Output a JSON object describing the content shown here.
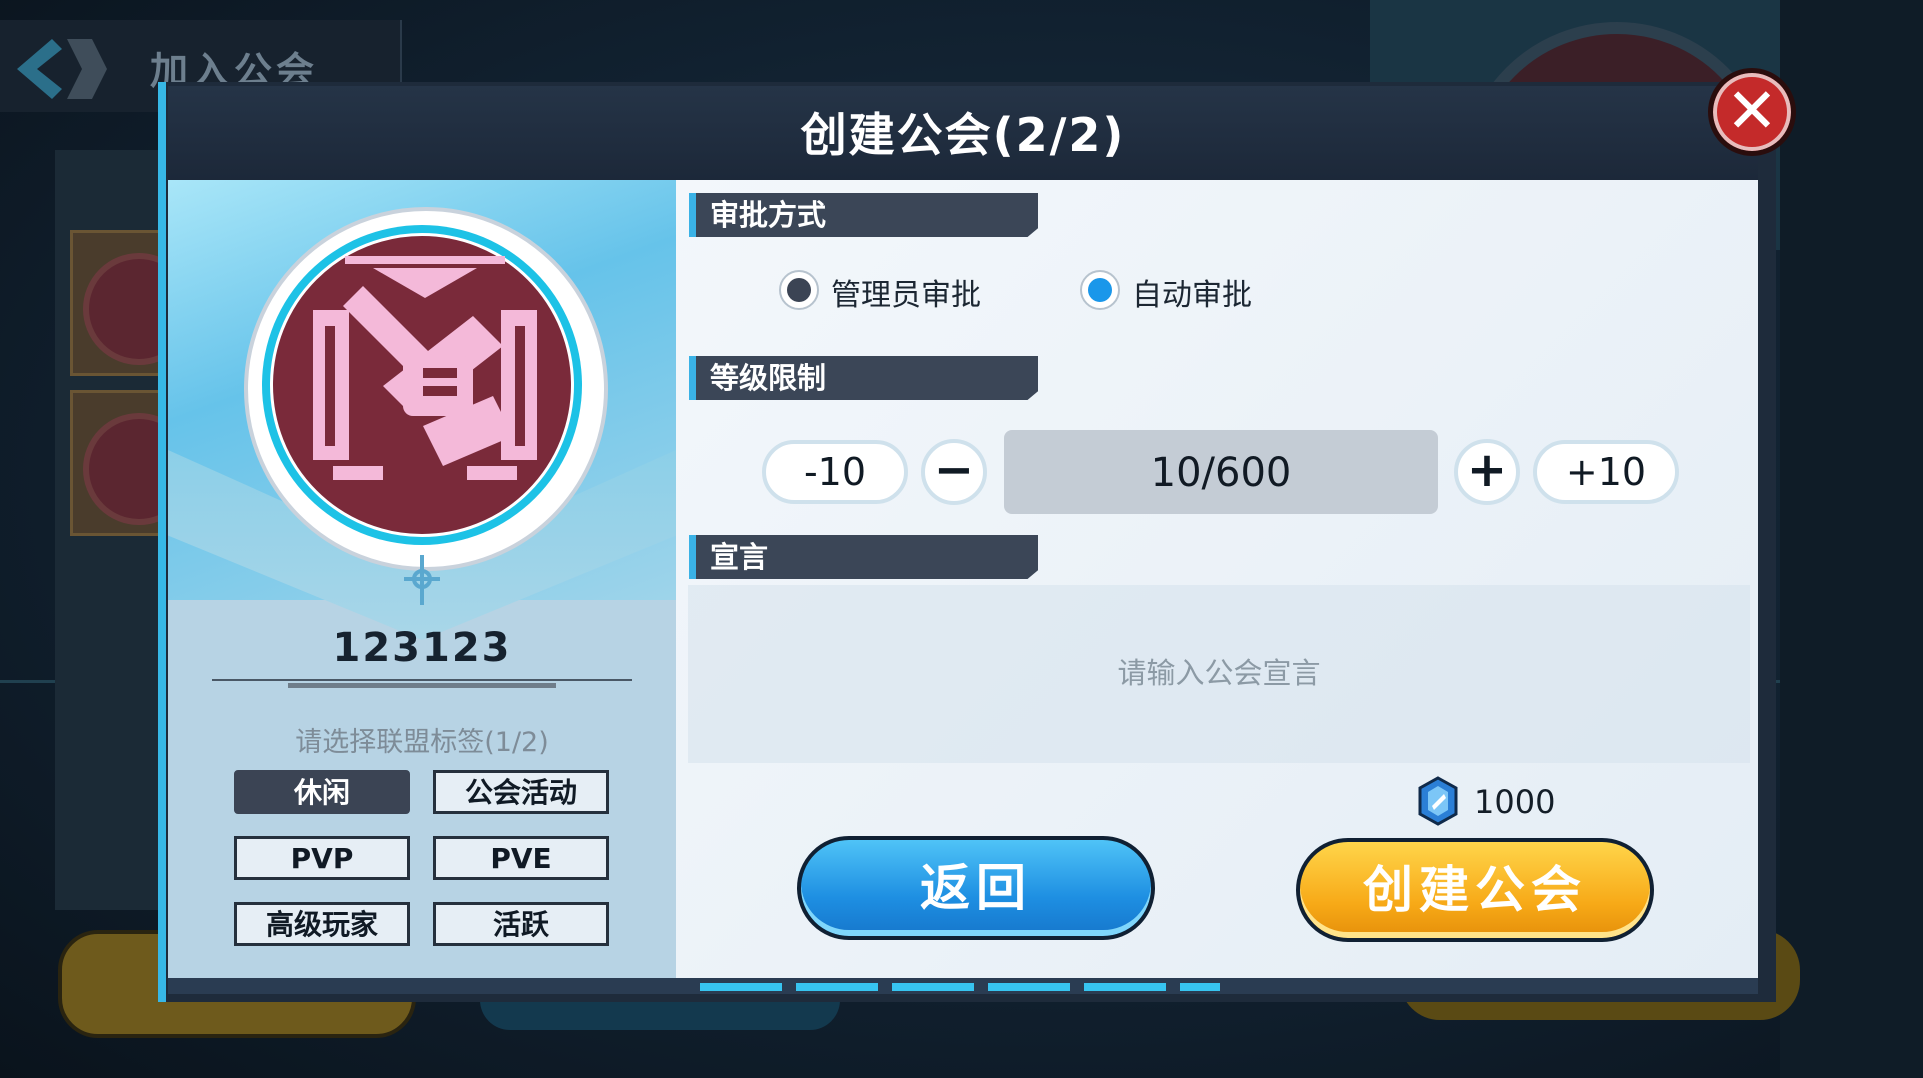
{
  "background": {
    "title": "加入公会"
  },
  "dialog": {
    "title": "创建公会(2/2)",
    "close_icon": "close-x-icon"
  },
  "left": {
    "guild_name": "123123",
    "tag_hint": "请选择联盟标签(1/2)",
    "tags": [
      {
        "label": "休闲",
        "selected": true
      },
      {
        "label": "公会活动",
        "selected": false
      },
      {
        "label": "PVP",
        "selected": false
      },
      {
        "label": "PVE",
        "selected": false
      },
      {
        "label": "高级玩家",
        "selected": false
      },
      {
        "label": "活跃",
        "selected": false
      }
    ]
  },
  "approval": {
    "header": "审批方式",
    "options": [
      {
        "label": "管理员审批",
        "selected": false
      },
      {
        "label": "自动审批",
        "selected": true
      }
    ]
  },
  "level": {
    "header": "等级限制",
    "minus10": "-10",
    "minus_icon": "minus-icon",
    "value": "10/600",
    "plus_icon": "plus-icon",
    "plus10": "+10"
  },
  "manifesto": {
    "header": "宣言",
    "placeholder": "请输入公会宣言"
  },
  "cost": {
    "icon": "blue-gem-icon",
    "value": "1000"
  },
  "buttons": {
    "back": "返回",
    "create": "创建公会"
  },
  "colors": {
    "accent_blue": "#37b8e6",
    "selected_radio": "#1a97ea",
    "create_button": "#f7a917",
    "back_button": "#1e8fe2",
    "close_button": "#c42a2a"
  }
}
